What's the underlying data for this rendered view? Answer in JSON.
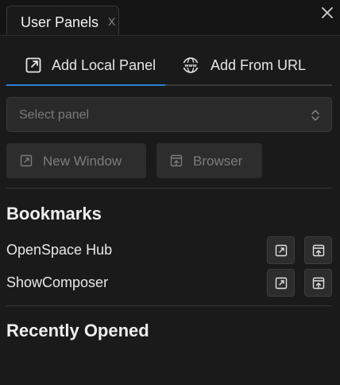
{
  "tab": {
    "title": "User Panels",
    "close_glyph": "X"
  },
  "subtabs": [
    {
      "label": "Add Local Panel",
      "icon": "external-window-icon",
      "active": true
    },
    {
      "label": "Add From URL",
      "icon": "www-globe-icon",
      "active": false
    }
  ],
  "select": {
    "placeholder": "Select panel"
  },
  "buttons": {
    "new_window": "New Window",
    "browser": "Browser"
  },
  "bookmarks": {
    "heading": "Bookmarks",
    "items": [
      {
        "name": "OpenSpace Hub"
      },
      {
        "name": "ShowComposer"
      }
    ]
  },
  "recent": {
    "heading": "Recently Opened"
  },
  "colors": {
    "accent": "#2f7fd6",
    "background": "#1a1a1a",
    "button": "#2d2d2d"
  }
}
